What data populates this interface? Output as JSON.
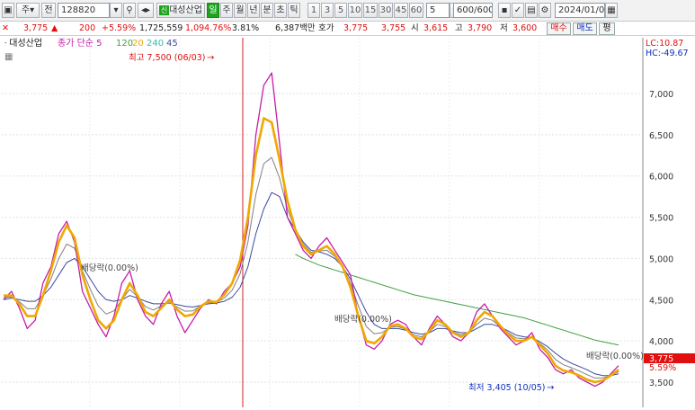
{
  "toolbar": {
    "type": "주",
    "code": "128820",
    "name": "대성산업",
    "periods": [
      "일",
      "주",
      "월",
      "년",
      "분",
      "초",
      "틱"
    ],
    "active_period": "일",
    "intervals": [
      "1",
      "3",
      "5",
      "10",
      "15",
      "30",
      "45",
      "60"
    ],
    "interval_value": "5",
    "count": "600/600",
    "date": "2024/01/04",
    "jeon": "전"
  },
  "quote": {
    "price": "3,775",
    "change": "200",
    "change_pct": "+5.59%",
    "volume": "1,725,559",
    "vol_ratio": "1,094.76%",
    "turnover": "3.81%",
    "amount": "6,387백만",
    "ho_label": "호가",
    "ask": "3,775",
    "bid": "3,755",
    "open_label": "시",
    "open": "3,615",
    "high_label": "고",
    "high": "3,790",
    "low_label": "저",
    "low": "3,600",
    "buy": "매수",
    "sell": "매도",
    "eval": "평"
  },
  "legend": {
    "name": "대성산업",
    "price_ma": "종가 단순 5",
    "ma120": "120",
    "ma20": "20",
    "ma240": "240",
    "ma45": "45"
  },
  "colors": {
    "price": "#c41ea8",
    "ma5": "#f0a800",
    "ma20": "#808080",
    "ma45": "#3c4a9c",
    "ma120": "#40a040",
    "ma240": "#30c0b0",
    "up": "#e01010",
    "down": "#1030c0"
  },
  "chart_data": {
    "type": "line",
    "ylim": [
      3300,
      7900
    ],
    "yticks": [
      "7,000",
      "6,500",
      "6,000",
      "5,500",
      "5,000",
      "4,500",
      "4,000",
      "3,500"
    ],
    "lc": "LC:10.87",
    "hc": "HC:-49.67",
    "current_price": "3,775",
    "current_pct": "5.59%",
    "high_note": "최고 7,500 (06/03)",
    "low_note": "최저 3,405 (10/05)",
    "dividend": "배당락(0.00%)",
    "price_series": [
      4500,
      4600,
      4400,
      4150,
      4250,
      4700,
      4900,
      5300,
      5450,
      5200,
      4600,
      4400,
      4200,
      4050,
      4300,
      4700,
      4850,
      4500,
      4300,
      4200,
      4450,
      4600,
      4300,
      4100,
      4250,
      4400,
      4500,
      4450,
      4600,
      4700,
      4900,
      5400,
      6500,
      7100,
      7250,
      6400,
      5500,
      5300,
      5100,
      5000,
      5150,
      5250,
      5100,
      4950,
      4800,
      4300,
      3950,
      3900,
      4000,
      4200,
      4250,
      4200,
      4050,
      3950,
      4150,
      4300,
      4200,
      4050,
      4000,
      4100,
      4350,
      4450,
      4300,
      4150,
      4050,
      3950,
      4000,
      4100,
      3900,
      3800,
      3650,
      3600,
      3650,
      3550,
      3500,
      3450,
      3500,
      3600,
      3700
    ],
    "ma5_series": [
      4550,
      4550,
      4450,
      4300,
      4300,
      4550,
      4850,
      5200,
      5400,
      5250,
      4800,
      4500,
      4250,
      4150,
      4250,
      4500,
      4700,
      4550,
      4350,
      4300,
      4400,
      4500,
      4380,
      4300,
      4320,
      4420,
      4480,
      4470,
      4560,
      4700,
      4980,
      5500,
      6250,
      6700,
      6650,
      6200,
      5700,
      5350,
      5150,
      5050,
      5100,
      5150,
      5050,
      4900,
      4650,
      4300,
      4000,
      3970,
      4050,
      4180,
      4200,
      4150,
      4050,
      4020,
      4120,
      4250,
      4200,
      4100,
      4050,
      4100,
      4250,
      4350,
      4300,
      4180,
      4080,
      4000,
      4000,
      4050,
      3950,
      3850,
      3700,
      3640,
      3620,
      3580,
      3530,
      3500,
      3520,
      3580,
      3650
    ],
    "ma20_series": [
      4500,
      4520,
      4500,
      4480,
      4480,
      4550,
      4650,
      4800,
      4950,
      5000,
      4900,
      4750,
      4600,
      4500,
      4480,
      4500,
      4550,
      4520,
      4480,
      4450,
      4450,
      4460,
      4440,
      4420,
      4410,
      4430,
      4450,
      4460,
      4480,
      4530,
      4650,
      4900,
      5300,
      5600,
      5800,
      5750,
      5500,
      5350,
      5200,
      5100,
      5080,
      5050,
      5000,
      4900,
      4750,
      4550,
      4350,
      4200,
      4150,
      4150,
      4150,
      4130,
      4100,
      4080,
      4100,
      4150,
      4150,
      4120,
      4100,
      4100,
      4150,
      4200,
      4200,
      4170,
      4120,
      4070,
      4050,
      4040,
      3990,
      3930,
      3850,
      3780,
      3730,
      3690,
      3650,
      3600,
      3580,
      3580,
      3600
    ],
    "ma120_series": [
      null,
      null,
      null,
      null,
      null,
      null,
      null,
      null,
      null,
      null,
      null,
      null,
      null,
      null,
      null,
      null,
      null,
      null,
      null,
      null,
      null,
      null,
      null,
      null,
      null,
      null,
      null,
      null,
      null,
      null,
      null,
      null,
      null,
      null,
      null,
      null,
      null,
      5050,
      5000,
      4960,
      4920,
      4890,
      4860,
      4830,
      4800,
      4770,
      4740,
      4710,
      4680,
      4650,
      4620,
      4590,
      4560,
      4540,
      4520,
      4500,
      4480,
      4460,
      4440,
      4420,
      4400,
      4380,
      4360,
      4340,
      4320,
      4300,
      4280,
      4250,
      4220,
      4190,
      4160,
      4130,
      4100,
      4070,
      4040,
      4010,
      3990,
      3970,
      3950
    ]
  }
}
